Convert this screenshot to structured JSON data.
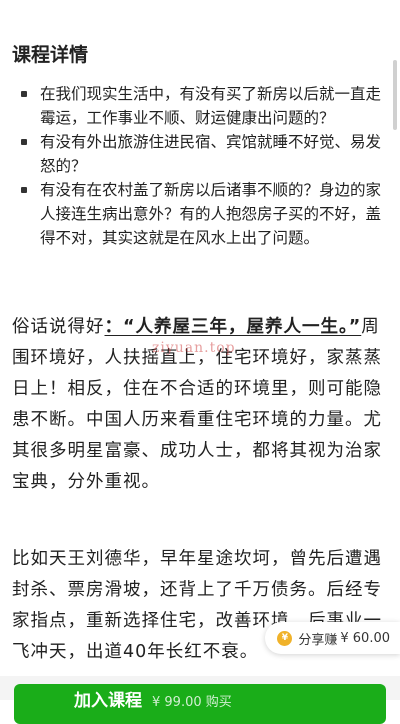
{
  "section": {
    "title": "课程详情"
  },
  "bullets": [
    "在我们现实生活中，有没有买了新房以后就一直走霉运，工作事业不顺、财运健康出问题的？",
    "有没有外出旅游住进民宿、宾馆就睡不好觉、易发怒的？",
    "有没有在农村盖了新房以后诸事不顺的？身边的家人接连生病出意外？有的人抱怨房子买的不好，盖得不对，其实这就是在风水上出了问题。"
  ],
  "para1": {
    "prefix": "俗话说得好",
    "quote": "：“人养屋三年，屋养人一生。”",
    "rest": "周围环境好，人扶摇直上，住宅环境好，家蒸蒸日上！相反，住在不合适的环境里，则可能隐患不断。中国人历来看重住宅环境的力量。尤其很多明星富豪、成功人士，都将其视为治家宝典，分外重视。"
  },
  "para2": "比如天王刘德华，早年星途坎坷，曾先后遭遇封杀、票房滑坡，还背上了千万债务。后经专家指点，重新选择住宅，改善环境，后事业一飞冲天，出道40年长红不衰。",
  "watermark": "ziyuan.top",
  "share": {
    "label": "分享赚",
    "price": "¥ 60.00",
    "icon": "coin-icon"
  },
  "join": {
    "label": "加入课程",
    "sub": "¥ 99.00 购买"
  },
  "colors": {
    "accent": "#1aad19",
    "coin": "#f0b22a"
  }
}
